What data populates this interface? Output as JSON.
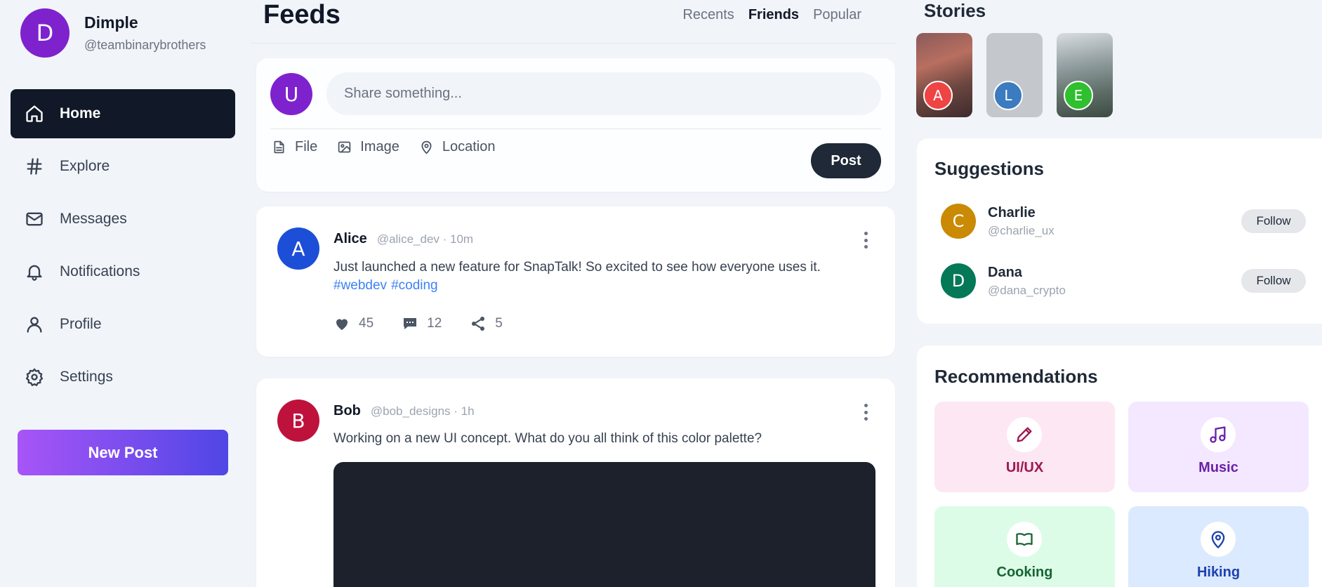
{
  "profile": {
    "initial": "D",
    "name": "Dimple",
    "handle": "@teambinarybrothers",
    "avatar_color": "#7e22ce"
  },
  "nav": [
    {
      "id": "home",
      "label": "Home",
      "icon": "home-icon",
      "active": true
    },
    {
      "id": "explore",
      "label": "Explore",
      "icon": "hash-icon",
      "active": false
    },
    {
      "id": "messages",
      "label": "Messages",
      "icon": "mail-icon",
      "active": false
    },
    {
      "id": "notifications",
      "label": "Notifications",
      "icon": "bell-icon",
      "active": false
    },
    {
      "id": "profile",
      "label": "Profile",
      "icon": "user-icon",
      "active": false
    },
    {
      "id": "settings",
      "label": "Settings",
      "icon": "gear-icon",
      "active": false
    }
  ],
  "new_post_label": "New Post",
  "feeds": {
    "title": "Feeds",
    "tabs": [
      {
        "label": "Recents",
        "active": false
      },
      {
        "label": "Friends",
        "active": true
      },
      {
        "label": "Popular",
        "active": false
      }
    ]
  },
  "composer": {
    "initial": "U",
    "placeholder": "Share something...",
    "tools": [
      {
        "label": "File",
        "icon": "file-icon"
      },
      {
        "label": "Image",
        "icon": "image-icon"
      },
      {
        "label": "Location",
        "icon": "location-pin-icon"
      }
    ],
    "post_label": "Post"
  },
  "posts": [
    {
      "initial": "A",
      "avatar_color": "#1d4ed8",
      "author": "Alice",
      "byline": "@alice_dev · 10m",
      "text": "Just launched a new feature for SnapTalk! So excited to see how everyone uses it.",
      "tags": [
        "#webdev",
        "#coding"
      ],
      "likes": "45",
      "comments": "12",
      "shares": "5"
    },
    {
      "initial": "B",
      "avatar_color": "#be123c",
      "author": "Bob",
      "byline": "@bob_designs · 1h",
      "text": "Working on a new UI concept. What do you all think of this color palette?"
    }
  ],
  "stories": {
    "title": "Stories",
    "items": [
      {
        "initial": "A",
        "avatar_color": "#ef4444"
      },
      {
        "initial": "L",
        "avatar_color": "#3b7bbf"
      },
      {
        "initial": "E",
        "avatar_color": "#2fbf2f"
      }
    ]
  },
  "suggestions": {
    "title": "Suggestions",
    "items": [
      {
        "initial": "C",
        "avatar_color": "#ca8a04",
        "name": "Charlie",
        "handle": "@charlie_ux",
        "follow_label": "Follow"
      },
      {
        "initial": "D",
        "avatar_color": "#047857",
        "name": "Dana",
        "handle": "@dana_crypto",
        "follow_label": "Follow"
      }
    ]
  },
  "recommendations": {
    "title": "Recommendations",
    "items": [
      {
        "label": "UI/UX",
        "icon": "pencil-icon",
        "bg": "#fce7f3",
        "color": "#9d174d"
      },
      {
        "label": "Music",
        "icon": "music-note-icon",
        "bg": "#f3e8ff",
        "color": "#6b21a8"
      },
      {
        "label": "Cooking",
        "icon": "book-icon",
        "bg": "#dcfce7",
        "color": "#166534"
      },
      {
        "label": "Hiking",
        "icon": "location-pin-icon",
        "bg": "#dbeafe",
        "color": "#1e40af"
      }
    ]
  }
}
